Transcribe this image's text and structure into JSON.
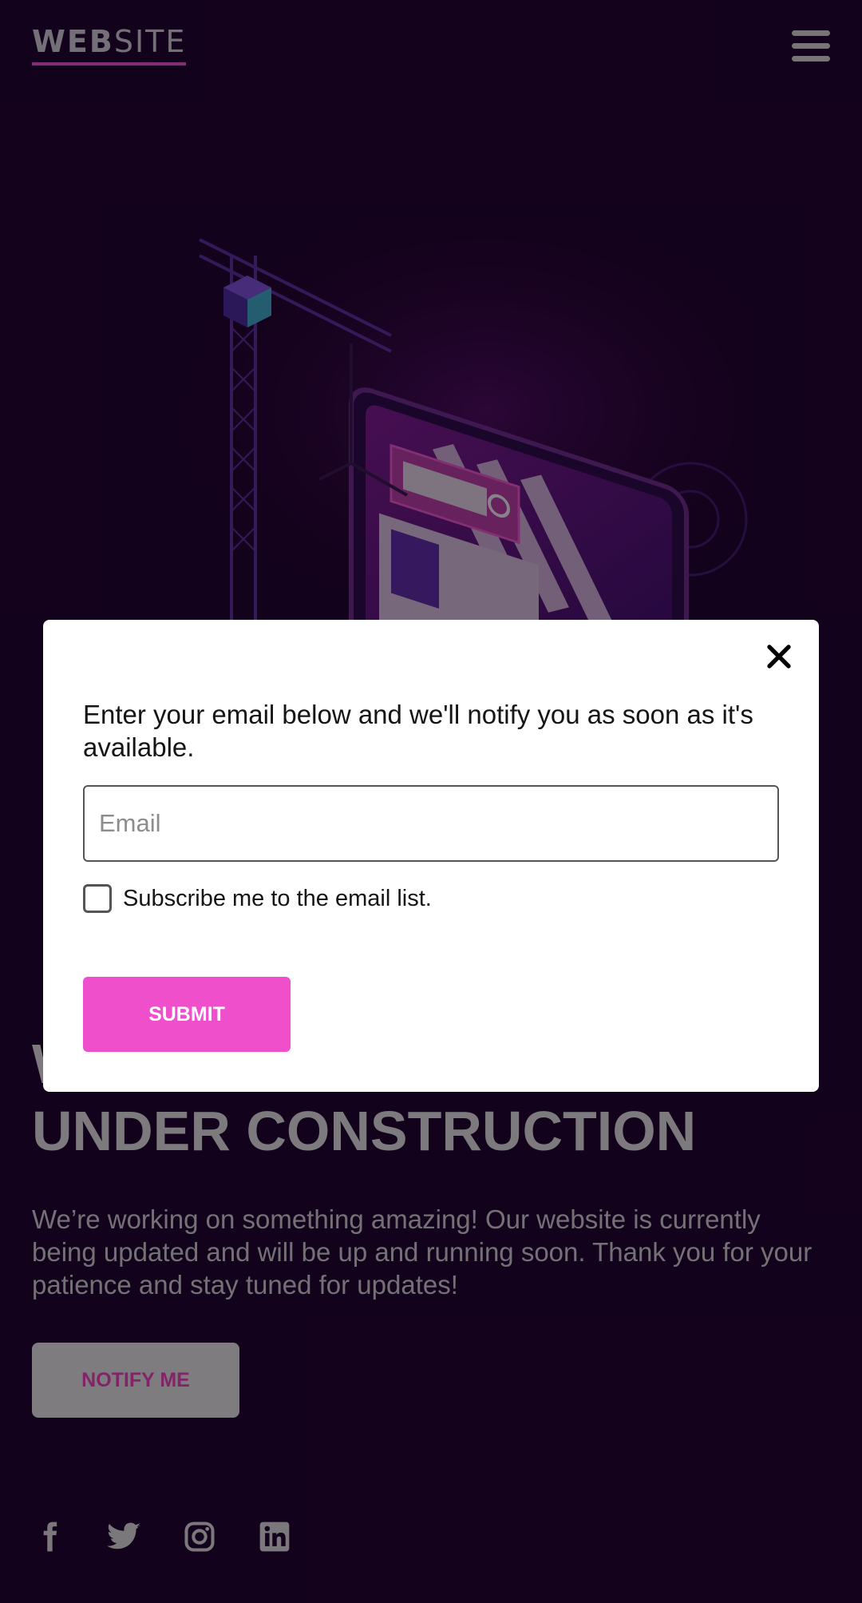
{
  "header": {
    "logo_bold": "WEB",
    "logo_thin": "SITE",
    "menu_icon": "hamburger-menu-icon"
  },
  "hero": {
    "illustration": "under-construction-crane-screen-illustration"
  },
  "main": {
    "headline_line1": "W",
    "headline_line2": "UNDER CONSTRUCTION",
    "description": "We’re working on something amazing! Our website is currently being updated and will be up and running soon. Thank you for your patience and stay tuned for updates!",
    "notify_label": "NOTIFY ME"
  },
  "social": {
    "icons": [
      "facebook-icon",
      "twitter-icon",
      "instagram-icon",
      "linkedin-icon"
    ]
  },
  "modal": {
    "message": "Enter your email below and we'll notify you as soon as it's available.",
    "email_placeholder": "Email",
    "email_value": "",
    "subscribe_label": "Subscribe me to the email list.",
    "subscribe_checked": false,
    "submit_label": "SUBMIT",
    "close_icon": "close-icon"
  },
  "colors": {
    "background": "#220430",
    "accent": "#ef4fcb",
    "logo_underline": "#e052c8"
  }
}
